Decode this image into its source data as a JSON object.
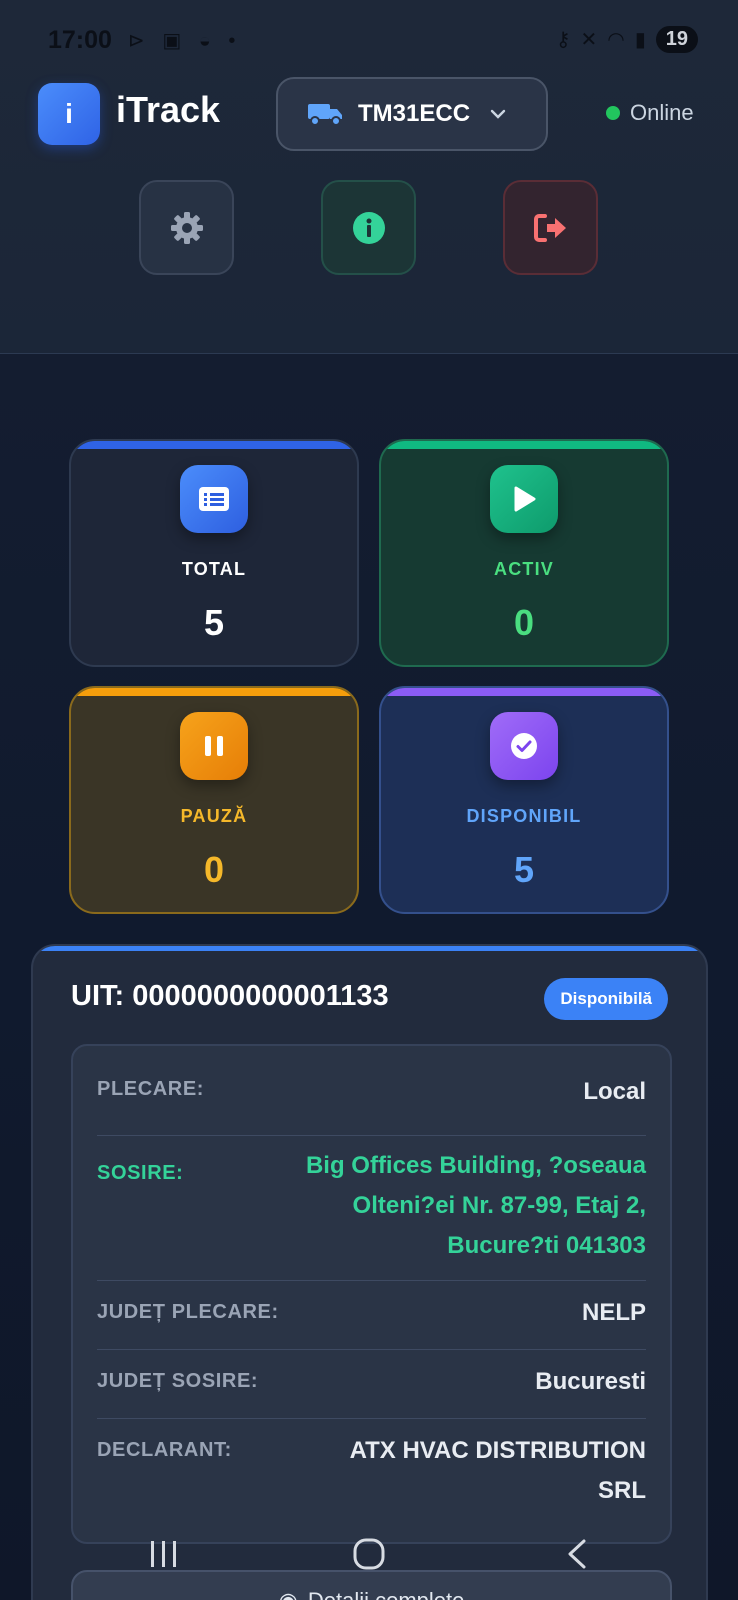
{
  "status_bar": {
    "time": "17:00",
    "left_icons": "⊳ ▣ ◒ •",
    "battery": "19"
  },
  "header": {
    "logo_letter": "i",
    "app_title": "iTrack",
    "vehicle": "TM31ECC",
    "connection_status": "Online",
    "status_color": "#22c55e"
  },
  "stats": {
    "total": {
      "label": "TOTAL",
      "value": "5"
    },
    "activ": {
      "label": "ACTIV",
      "value": "0"
    },
    "pauza": {
      "label": "PAUZĂ",
      "value": "0"
    },
    "disponibil": {
      "label": "DISPONIBIL",
      "value": "5"
    }
  },
  "route": {
    "uit": "UIT: 0000000000001133",
    "badge": "Disponibilă",
    "plecare_label": "PLECARE:",
    "plecare_value": "Local",
    "sosire_label": "SOSIRE:",
    "sosire_value": "Big Offices Building, ?oseaua Olteni?ei Nr. 87-99, Etaj 2, Bucure?ti 041303",
    "judet_plecare_label": "JUDEȚ PLECARE:",
    "judet_plecare_value": "NELP",
    "judet_sosire_label": "JUDEȚ SOSIRE:",
    "judet_sosire_value": "Bucuresti",
    "declarant_label": "DECLARANT:",
    "declarant_value": "ATX HVAC DISTRIBUTION SRL",
    "details_button": "Detalii complete"
  },
  "colors": {
    "accent_blue": "#3b82f6",
    "green": "#34d399",
    "amber": "#f5b82a",
    "violet": "#8b5cf6"
  }
}
